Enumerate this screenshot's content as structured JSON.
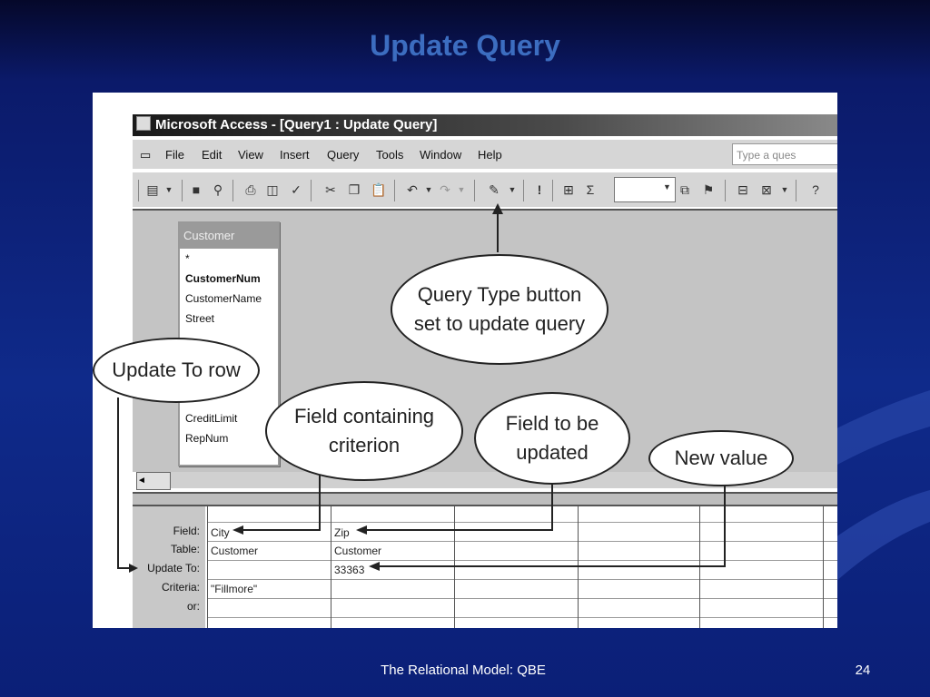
{
  "slide": {
    "title": "Update Query",
    "footer": "The Relational Model: QBE",
    "page_number": "24"
  },
  "window": {
    "title": "Microsoft Access - [Query1 : Update Query]",
    "help_placeholder": "Type a ques"
  },
  "menu": [
    "File",
    "Edit",
    "View",
    "Insert",
    "Query",
    "Tools",
    "Window",
    "Help"
  ],
  "field_list": {
    "title": "Customer",
    "items": [
      "*",
      "CustomerNum",
      "CustomerName",
      "Street",
      "CreditLimit",
      "RepNum"
    ]
  },
  "grid": {
    "row_labels": [
      "Field:",
      "Table:",
      "Update To:",
      "Criteria:",
      "or:"
    ],
    "columns": [
      {
        "field": "City",
        "table": "Customer",
        "update_to": "",
        "criteria": "\"Fillmore\""
      },
      {
        "field": "Zip",
        "table": "Customer",
        "update_to": "33363",
        "criteria": ""
      }
    ]
  },
  "callouts": {
    "query_type": "Query Type button set to update query",
    "update_to_row": "Update To row",
    "field_criterion": "Field containing criterion",
    "field_updated": "Field to be updated",
    "new_value": "New value"
  },
  "colors": {
    "title": "#3c6dc0",
    "background": "#0f2a8a"
  }
}
